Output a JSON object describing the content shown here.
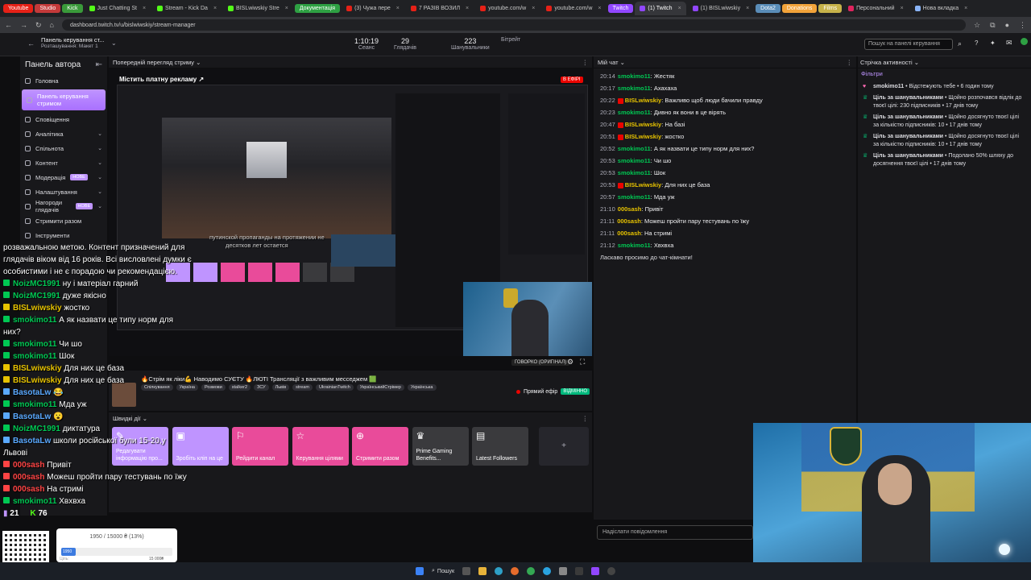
{
  "browser": {
    "tabs": [
      {
        "label": "Youtube",
        "color": "#e62117",
        "style": "colored"
      },
      {
        "label": "Studio",
        "color": "#c43a3a",
        "style": "colored"
      },
      {
        "label": "Kick",
        "color": "#3a9a3a",
        "style": "colored"
      },
      {
        "label": "Just Chatting St",
        "color": "#53fc18"
      },
      {
        "label": "Stream - Kick Da",
        "color": "#53fc18"
      },
      {
        "label": "BISLwiwskiy Stre",
        "color": "#53fc18"
      },
      {
        "label": "Документація",
        "color": "#2ea043",
        "style": "colored"
      },
      {
        "label": "(3) Чужа пере",
        "color": "#e62117"
      },
      {
        "label": "7 РАЗІВ ВОЗИЛ",
        "color": "#e62117"
      },
      {
        "label": "youtube.com/w",
        "color": "#e62117"
      },
      {
        "label": "youtube.com/w",
        "color": "#e62117"
      },
      {
        "label": "Twitch",
        "color": "#9147ff",
        "style": "colored"
      },
      {
        "label": "(1) Twitch",
        "color": "#9147ff",
        "active": true
      },
      {
        "label": "(1) BISLwiwskiy",
        "color": "#9147ff"
      },
      {
        "label": "Dota2",
        "color": "#5a8db8",
        "style": "colored"
      },
      {
        "label": "Donations",
        "color": "#f2a33a",
        "style": "colored"
      },
      {
        "label": "Films",
        "color": "#c6b24a",
        "style": "colored"
      },
      {
        "label": "Персональний",
        "color": "#e0245e"
      },
      {
        "label": "Нова вкладка",
        "color": "#8ab4f8"
      }
    ],
    "url": "dashboard.twitch.tv/u/bislwiwskiy/stream-manager"
  },
  "topnav": {
    "dashboard_title": "Панель керування ст...",
    "dashboard_subtitle": "Розташування: Макет 1",
    "stats": [
      {
        "value": "1:10:19",
        "label": "Сеанс"
      },
      {
        "value": "29",
        "label": "Глядачів"
      },
      {
        "value": "223",
        "label": "Шанувальники"
      },
      {
        "value": "",
        "label": "Бітрейт"
      }
    ],
    "search_placeholder": "Пошук на панелі керування"
  },
  "sidebar": {
    "title": "Панель автора",
    "items": [
      {
        "label": "Головна",
        "icon": "home-icon"
      },
      {
        "label": "Панель керування стримом",
        "icon": "stream-icon",
        "active": true
      },
      {
        "label": "Сповіщення",
        "icon": "bell-icon"
      },
      {
        "label": "Аналітика",
        "icon": "analytics-icon",
        "chevron": true
      },
      {
        "label": "Спільнота",
        "icon": "community-icon",
        "chevron": true
      },
      {
        "label": "Контент",
        "icon": "content-icon",
        "chevron": true
      },
      {
        "label": "Модерація",
        "icon": "shield-icon",
        "badge": "НОВЕ",
        "chevron": true
      },
      {
        "label": "Налаштування",
        "icon": "gear-icon",
        "chevron": true
      },
      {
        "label": "Нагороди глядачів",
        "icon": "gift-icon",
        "badge": "НОВЕ",
        "chevron": true
      },
      {
        "label": "Стримити разом",
        "icon": "people-icon"
      },
      {
        "label": "Інструменти",
        "icon": "tools-icon"
      }
    ]
  },
  "preview": {
    "header": "Попередній перегляд стриму",
    "paid_promo": "Містить платну рекламу",
    "live_badge": "В ЕФІРІ",
    "subtitle_line1": "путинской пропаганды на протяжении не",
    "subtitle_line2": "десятков лет остается",
    "audio_label": "ГОВОРКО (ОРИГІНАЛ)"
  },
  "stream_info": {
    "title": "🔥Стрім як ліки💪 Наводимо СУЄТУ 🔥ЛЮТІ Трансляції з важливим месседжем 🟩",
    "tags": [
      "Спілкування",
      "Україна",
      "Розмови",
      "stalker2",
      "ЗСУ",
      "Львів",
      "stream",
      "UkrainianTwitch",
      "УкраїнськийСтрімер",
      "Українська"
    ],
    "status": "Прямий ефір",
    "status_badge": "ВІДМІННО"
  },
  "quick_actions": {
    "header": "Швидкі дії",
    "cards": [
      {
        "label": "Редагувати інформацію про...",
        "color": "#bf94ff"
      },
      {
        "label": "Зробіть кліп на це",
        "color": "#bf94ff"
      },
      {
        "label": "Рейдити канал",
        "color": "#e94b9a"
      },
      {
        "label": "Керування цілями",
        "color": "#e94b9a"
      },
      {
        "label": "Стримити разом",
        "color": "#e94b9a"
      },
      {
        "label": "Prime Gaming Benefits...",
        "color": "#3a3a3d"
      },
      {
        "label": "Latest Followers",
        "color": "#3a3a3d"
      }
    ],
    "add_symbol": "+"
  },
  "chat": {
    "header": "Мій чат",
    "messages": [
      {
        "time": "20:14",
        "user": "smokimo11",
        "color": "#00c853",
        "text": "Жестяк"
      },
      {
        "time": "20:17",
        "user": "smokimo11",
        "color": "#00c853",
        "text": "Ахахаха"
      },
      {
        "time": "20:22",
        "user": "BISLwiwskiy",
        "color": "#e6c200",
        "text": "Важливо щоб люди бачили правду"
      },
      {
        "time": "20:23",
        "user": "smokimo11",
        "color": "#00c853",
        "text": "Дивно як вони в це вірять"
      },
      {
        "time": "20:47",
        "user": "BISLwiwskiy",
        "color": "#e6c200",
        "text": "На базі"
      },
      {
        "time": "20:51",
        "user": "BISLwiwskiy",
        "color": "#e6c200",
        "text": "жостко"
      },
      {
        "time": "20:52",
        "user": "smokimo11",
        "color": "#00c853",
        "text": "А як назвати це типу норм для них?"
      },
      {
        "time": "20:53",
        "user": "smokimo11",
        "color": "#00c853",
        "text": "Чи шо"
      },
      {
        "time": "20:53",
        "user": "smokimo11",
        "color": "#00c853",
        "text": "Шок"
      },
      {
        "time": "20:53",
        "user": "BISLwiwskiy",
        "color": "#e6c200",
        "text": "Для них це база"
      },
      {
        "time": "20:57",
        "user": "smokimo11",
        "color": "#00c853",
        "text": "Мда уж"
      },
      {
        "time": "21:10",
        "user": "000sash",
        "color": "#e6c200",
        "text": "Привіт"
      },
      {
        "time": "21:11",
        "user": "000sash",
        "color": "#e6c200",
        "text": "Можеш пройти пару тестувань по їжу"
      },
      {
        "time": "21:11",
        "user": "000sash",
        "color": "#e6c200",
        "text": "На стримі"
      },
      {
        "time": "21:12",
        "user": "smokimo11",
        "color": "#00c853",
        "text": "Хвхвха"
      }
    ],
    "welcome": "Ласкаво просимо до чат-кімнати!",
    "input_placeholder": "Надіслати повідомлення"
  },
  "activity": {
    "header": "Стрічка активності",
    "filters": "Фільтри",
    "items": [
      {
        "icon": "heart-icon",
        "user": "smokimo11",
        "text": " • Відстежують тебе • 6 годин тому"
      },
      {
        "icon": "trophy-icon",
        "user": "Ціль за шанувальниками",
        "text": " • Щойно розпочався відлік до твоєї цілі: 230 підписників • 17 днів тому"
      },
      {
        "icon": "trophy-icon",
        "user": "Ціль за шанувальниками",
        "text": " • Щойно досягнуто твоєї цілі за кількістю підписників: 10 • 17 днів тому"
      },
      {
        "icon": "trophy-icon",
        "user": "Ціль за шанувальниками",
        "text": " • Щойно досягнуто твоєї цілі за кількістю підписників: 10 • 17 днів тому"
      },
      {
        "icon": "trophy-icon",
        "user": "Ціль за шанувальниками",
        "text": " • Подолано 50% шляху до досягнення твоєї цілі • 17 днів тому"
      }
    ]
  },
  "overlay_chat": {
    "lines": [
      {
        "user": "",
        "color": "#ffffff",
        "text": "розважальною метою. Контент призначений для"
      },
      {
        "user": "",
        "color": "#ffffff",
        "text": "глядачів віком від 16 років. Всі висловлені думки є"
      },
      {
        "user": "",
        "color": "#ffffff",
        "text": "особистими і не є порадою чи рекомендацією."
      },
      {
        "user": "NoizMC1991",
        "color": "#00c853",
        "text": "ну і матеріал гарний"
      },
      {
        "user": "NoizMC1991",
        "color": "#00c853",
        "text": "дуже якісно"
      },
      {
        "user": "BISLwiwskiy",
        "color": "#e6c200",
        "text": "жостко"
      },
      {
        "user": "smokimo11",
        "color": "#00c853",
        "text": "А як назвати це типу норм для"
      },
      {
        "user": "",
        "color": "#ffffff",
        "text": "них?"
      },
      {
        "user": "smokimo11",
        "color": "#00c853",
        "text": "Чи шо"
      },
      {
        "user": "smokimo11",
        "color": "#00c853",
        "text": "Шок"
      },
      {
        "user": "BISLwiwskiy",
        "color": "#e6c200",
        "text": "Для них це база"
      },
      {
        "user": "BISLwiwskiy",
        "color": "#e6c200",
        "text": "Для них це база"
      },
      {
        "user": "BasotaLw",
        "color": "#5aa9ff",
        "text": "😂"
      },
      {
        "user": "smokimo11",
        "color": "#00c853",
        "text": "Мда уж"
      },
      {
        "user": "BasotaLw",
        "color": "#5aa9ff",
        "text": "😮"
      },
      {
        "user": "NoizMC1991",
        "color": "#00c853",
        "text": "диктатура"
      },
      {
        "user": "BasotaLw",
        "color": "#5aa9ff",
        "text": "школи російської були 15-20,у"
      },
      {
        "user": "",
        "color": "#ffffff",
        "text": "Львові"
      },
      {
        "user": "000sash",
        "color": "#ff4444",
        "text": "Привіт"
      },
      {
        "user": "000sash",
        "color": "#ff4444",
        "text": "Можеш пройти пару тестувань по їжу"
      },
      {
        "user": "000sash",
        "color": "#ff4444",
        "text": "На стримі"
      },
      {
        "user": "smokimo11",
        "color": "#00c853",
        "text": "Хвхвха"
      }
    ],
    "viewers_count": "21",
    "kick_count": "76"
  },
  "goal_widget": {
    "progress_text": "1950 / 15000 ₴ (13%)",
    "progress_fraction": 0.13,
    "current": "1950",
    "goal": "15 000₴",
    "label": "Ціль:"
  },
  "taskbar": {
    "search_label": "Пошук"
  }
}
